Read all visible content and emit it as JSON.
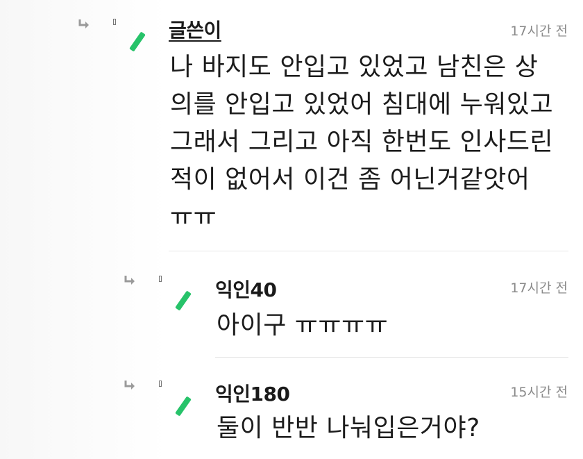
{
  "comments": [
    {
      "author": "글쓴이",
      "time": "17시간 전",
      "text": "나 바지도 안입고 있었고 남친은 상\n의를 안입고 있었어 침대에 누워있고\n그래서 그리고 아직 한번도 인사드린\n적이 없어서 이건 좀 어닌거같앗어\nㅠㅠ"
    },
    {
      "author": "익인40",
      "time": "17시간 전",
      "text": "아이구 ㅠㅠㅠㅠ"
    },
    {
      "author": "익인180",
      "time": "15시간 전",
      "text": "둘이 반반 나눠입은거야?"
    }
  ],
  "colors": {
    "accent_green": "#27c36a",
    "time_gray": "#8a8a8a"
  },
  "icons": {
    "reply": "reply-arrow-icon",
    "marker": "small-box-icon",
    "badge": "green-slash-icon"
  }
}
